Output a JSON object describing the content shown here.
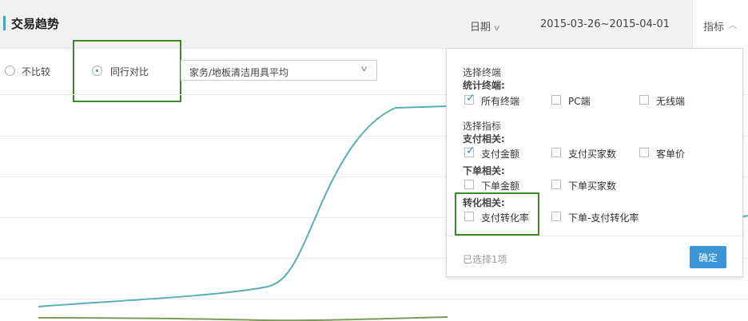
{
  "header": {
    "title": "交易趋势",
    "date_label": "日期",
    "date_range": "2015-03-26~2015-04-01",
    "metric_label": "指标"
  },
  "compare": {
    "options": [
      {
        "label": "不比较",
        "selected": false
      },
      {
        "label": "同行对比",
        "selected": true
      }
    ],
    "category_value": "家务/地板清洁用具平均"
  },
  "panel": {
    "terminal_section": "选择终端",
    "terminal_group": "统计终端:",
    "terminals": [
      {
        "label": "所有终端",
        "checked": true
      },
      {
        "label": "PC端",
        "checked": false
      },
      {
        "label": "无线端",
        "checked": false
      }
    ],
    "metric_section": "选择指标",
    "groups": [
      {
        "title": "支付相关:",
        "items": [
          {
            "label": "支付金额",
            "checked": true
          },
          {
            "label": "支付买家数",
            "checked": false
          },
          {
            "label": "客单价",
            "checked": false
          }
        ]
      },
      {
        "title": "下单相关:",
        "items": [
          {
            "label": "下单金额",
            "checked": false
          },
          {
            "label": "下单买家数",
            "checked": false
          }
        ]
      },
      {
        "title": "转化相关:",
        "items": [
          {
            "label": "支付转化率",
            "checked": false
          },
          {
            "label": "下单-支付转化率",
            "checked": false
          }
        ]
      }
    ],
    "selected_count": "已选择1项",
    "confirm_label": "确定"
  },
  "colors": {
    "accent": "#2fb0b6",
    "primary_line": "#5aafb0",
    "secondary_line": "#7a9a5a",
    "annotation": "#3a8a2a",
    "button": "#3a95d8"
  }
}
